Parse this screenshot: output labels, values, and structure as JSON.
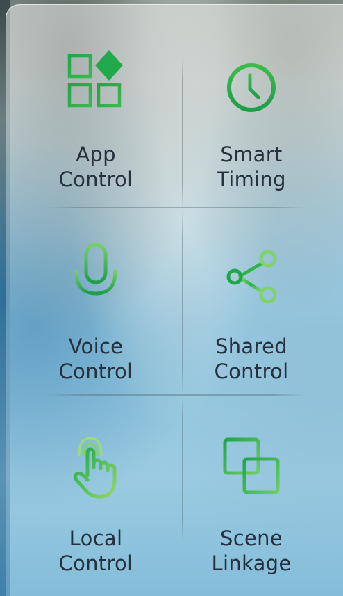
{
  "colors": {
    "icon_green": "#1fa54a",
    "icon_green_light": "#7fd36a",
    "label_text": "#27313d"
  },
  "features": [
    {
      "icon": "app-grid-icon",
      "line1": "App",
      "line2": "Control"
    },
    {
      "icon": "stopwatch-icon",
      "line1": "Smart",
      "line2": "Timing"
    },
    {
      "icon": "microphone-icon",
      "line1": "Voice",
      "line2": "Control"
    },
    {
      "icon": "share-icon",
      "line1": "Shared",
      "line2": "Control"
    },
    {
      "icon": "touch-hand-icon",
      "line1": "Local",
      "line2": "Control"
    },
    {
      "icon": "linked-squares-icon",
      "line1": "Scene",
      "line2": "Linkage"
    }
  ]
}
